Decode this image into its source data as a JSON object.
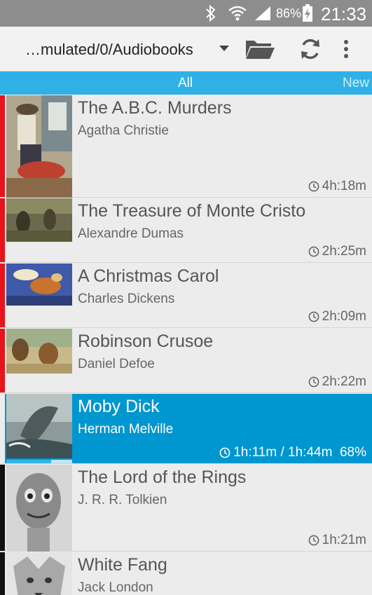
{
  "status_bar": {
    "battery_percent": "86%",
    "clock": "21:33",
    "icons": [
      "bluetooth-icon",
      "wifi-icon",
      "signal-icon",
      "battery-charging-icon"
    ]
  },
  "toolbar": {
    "path": "…mulated/0/Audiobooks",
    "icons": [
      "dropdown-arrow-icon",
      "folder-icon",
      "refresh-icon",
      "overflow-menu-icon"
    ]
  },
  "tabs": [
    {
      "label": "All",
      "active": true
    },
    {
      "label": "New",
      "active": false
    }
  ],
  "colors": {
    "accent": "#30b1e6",
    "selected_row": "#0096cf",
    "status_unread": "#e8131b",
    "status_finished": "#111111"
  },
  "books": [
    {
      "title": "The A.B.C. Murders",
      "author": "Agatha Christie",
      "duration": "4h:18m",
      "status": "unread"
    },
    {
      "title": "The Treasure of Monte Cristo",
      "author": "Alexandre Dumas",
      "duration": "2h:25m",
      "status": "unread"
    },
    {
      "title": "A Christmas Carol",
      "author": "Charles Dickens",
      "duration": "2h:09m",
      "status": "unread"
    },
    {
      "title": "Robinson Crusoe",
      "author": "Daniel Defoe",
      "duration": "2h:22m",
      "status": "unread"
    },
    {
      "title": "Moby Dick",
      "author": "Herman Melville",
      "duration": "1h:11m / 1h:44m  68%",
      "status": "in-progress",
      "progress": 0.68
    },
    {
      "title": "The Lord of the Rings",
      "author": "J. R. R. Tolkien",
      "duration": "1h:21m",
      "status": "finished"
    },
    {
      "title": "White Fang",
      "author": "Jack London",
      "duration": "",
      "status": "finished"
    }
  ]
}
